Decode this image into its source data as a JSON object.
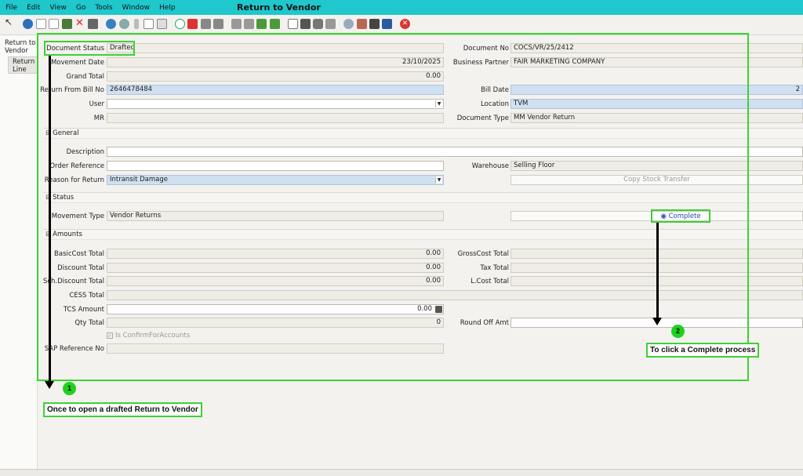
{
  "menu": {
    "items": [
      "File",
      "Edit",
      "View",
      "Go",
      "Tools",
      "Window",
      "Help"
    ],
    "window_title": "Return to Vendor"
  },
  "sidebar": {
    "tab_main": "Return to Vendor",
    "tab_line": "Return Line"
  },
  "form": {
    "document_status": {
      "label": "Document Status",
      "value": "Drafted"
    },
    "document_no": {
      "label": "Document No",
      "value": "COCS/VR/25/2412"
    },
    "movement_date": {
      "label": "Movement Date",
      "value": "23/10/2025"
    },
    "business_partner": {
      "label": "Business Partner",
      "value": "FAIR MARKETING COMPANY"
    },
    "grand_total": {
      "label": "Grand Total",
      "value": "0.00"
    },
    "return_from_bill_no": {
      "label": "Return From Bill No",
      "value": "2646478484"
    },
    "bill_date": {
      "label": "Bill Date",
      "value": "2"
    },
    "user": {
      "label": "User",
      "value": ""
    },
    "location": {
      "label": "Location",
      "value": "TVM"
    },
    "mr": {
      "label": "MR",
      "value": ""
    },
    "document_type": {
      "label": "Document Type",
      "value": "MM Vendor Return"
    }
  },
  "general": {
    "header": "General",
    "description": {
      "label": "Description",
      "value": ""
    },
    "order_reference": {
      "label": "Order Reference",
      "value": ""
    },
    "warehouse": {
      "label": "Warehouse",
      "value": "Selling Floor"
    },
    "reason_for_return": {
      "label": "Reason for Return",
      "value": "Intransit Damage"
    },
    "copy_stock_transfer": "Copy Stock Transfer"
  },
  "status": {
    "header": "Status",
    "movement_type": {
      "label": "Movement Type",
      "value": "Vendor Returns"
    },
    "complete_button": "Complete"
  },
  "amounts": {
    "header": "Amounts",
    "basic_cost_total": {
      "label": "BasicCost Total",
      "value": "0.00"
    },
    "gross_cost_total": {
      "label": "GrossCost Total",
      "value": ""
    },
    "discount_total": {
      "label": "Discount Total",
      "value": "0.00"
    },
    "tax_total": {
      "label": "Tax Total",
      "value": ""
    },
    "sch_discount_total": {
      "label": "Sch.Discount Total",
      "value": "0.00"
    },
    "l_cost_total": {
      "label": "L.Cost Total",
      "value": ""
    },
    "cess_total": {
      "label": "CESS Total",
      "value": ""
    },
    "tcs_amount": {
      "label": "TCS Amount",
      "value": "0.00"
    },
    "qty_total": {
      "label": "Qty Total",
      "value": "0"
    },
    "round_off_amt": {
      "label": "Round Off Amt",
      "value": ""
    },
    "is_confirm_for_accounts": "Is ConfirmForAccounts",
    "sap_reference_no": {
      "label": "SAP Reference No",
      "value": ""
    }
  },
  "annotations": {
    "step1_number": "1",
    "step1_text": "Once to open a drafted Return to Vendor",
    "step2_number": "2",
    "step2_text": "To click a Complete process"
  },
  "colors": {
    "menubar": "#1ec8cc",
    "highlight": "#3ed134",
    "field_blue": "#cfe0f2"
  }
}
